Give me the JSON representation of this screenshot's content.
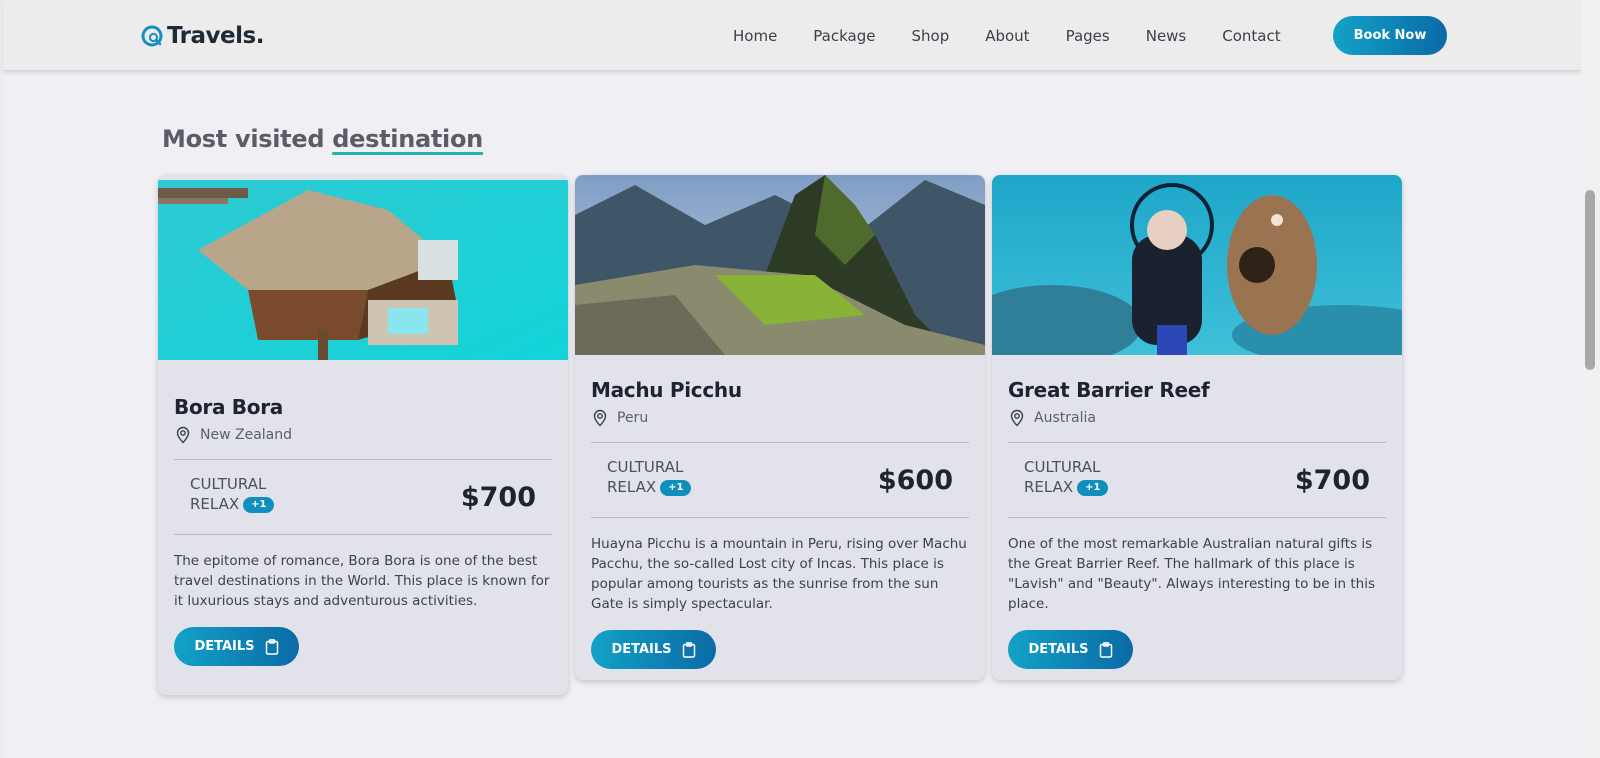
{
  "header": {
    "logo_text": "Travels.",
    "nav": [
      "Home",
      "Package",
      "Shop",
      "About",
      "Pages",
      "News",
      "Contact"
    ],
    "cta": "Book Now"
  },
  "section": {
    "title_plain": "Most visited",
    "title_accent": "destination"
  },
  "cards": [
    {
      "title": "Bora Bora",
      "location": "New Zealand",
      "tag1": "CULTURAL",
      "tag2": "RELAX",
      "badge": "+1",
      "price": "$700",
      "description": "The epitome of romance, Bora Bora is one of the best travel destinations in the World. This place is known for it luxurious stays and adventurous activities.",
      "button": "DETAILS"
    },
    {
      "title": "Machu Picchu",
      "location": "Peru",
      "tag1": "CULTURAL",
      "tag2": "RELAX",
      "badge": "+1",
      "price": "$600",
      "description": "Huayna Picchu is a mountain in Peru, rising over Machu Pacchu, the so-called Lost city of Incas. This place is popular among tourists as the sunrise from the sun Gate is simply spectacular.",
      "button": "DETAILS"
    },
    {
      "title": "Great Barrier Reef",
      "location": "Australia",
      "tag1": "CULTURAL",
      "tag2": "RELAX",
      "badge": "+1",
      "price": "$700",
      "description": "One of the most remarkable Australian natural gifts is the Great Barrier Reef. The hallmark of this place is \"Lavish\" and \"Beauty\". Always interesting to be in this place.",
      "button": "DETAILS"
    }
  ],
  "colors": {
    "accent_start": "#12a2c7",
    "accent_end": "#0b6aa6",
    "underline": "#20b3b0"
  }
}
